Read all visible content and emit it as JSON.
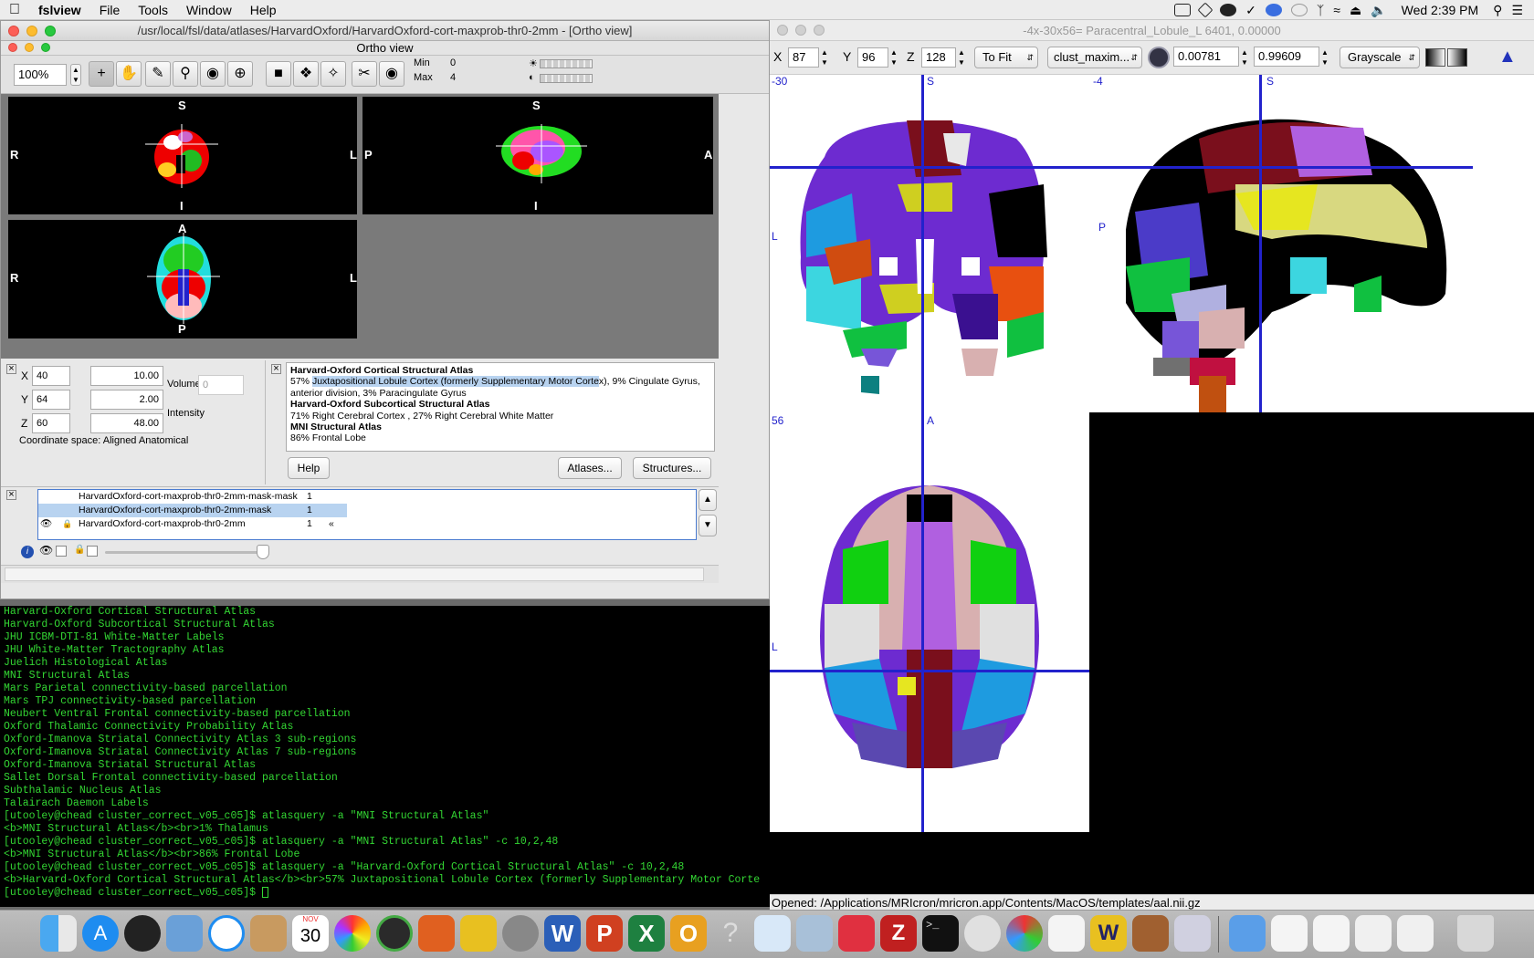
{
  "menubar": {
    "app_name": "fslview",
    "items": [
      "File",
      "Tools",
      "Window",
      "Help"
    ],
    "clock": "Wed 2:39 PM"
  },
  "fsl_window": {
    "title": "/usr/local/fsl/data/atlases/HarvardOxford/HarvardOxford-cort-maxprob-thr0-2mm - [Ortho view]",
    "subtitle": "Ortho view",
    "zoom": "100%",
    "min_label": "Min",
    "min_value": "0",
    "max_label": "Max",
    "max_value": "4",
    "views": {
      "coronal": {
        "top": "S",
        "bottom": "I",
        "left": "R",
        "right": "L"
      },
      "sagittal": {
        "top": "S",
        "bottom": "I",
        "left": "P",
        "right": "A"
      },
      "axial": {
        "top": "A",
        "bottom": "P",
        "left": "R",
        "right": "L"
      }
    },
    "coords": {
      "x_label": "X",
      "x_voxel": "40",
      "x_mm": "10.00",
      "y_label": "Y",
      "y_voxel": "64",
      "y_mm": "2.00",
      "z_label": "Z",
      "z_voxel": "60",
      "z_mm": "48.00",
      "volume_label": "Volume",
      "volume_value": "0",
      "intensity_label": "Intensity",
      "space": "Coordinate space: Aligned Anatomical"
    },
    "atlas_info": {
      "h1": "Harvard-Oxford Cortical Structural Atlas",
      "l1_pre": "57% ",
      "l1_hl": "Juxtapositional Lobule Cortex (formerly Supplementary Motor Corte",
      "l1_post": "x), 9% Cingulate Gyrus,",
      "l2": "anterior division, 3% Paracingulate Gyrus",
      "h2": "Harvard-Oxford Subcortical Structural Atlas",
      "l3": "71% Right Cerebral Cortex , 27% Right Cerebral White Matter",
      "h3": "MNI Structural Atlas",
      "l4": "86% Frontal Lobe",
      "help": "Help",
      "atlases": "Atlases...",
      "structures": "Structures..."
    },
    "layers": [
      {
        "name": "HarvardOxford-cort-maxprob-thr0-2mm-mask-mask",
        "value": "1"
      },
      {
        "name": "HarvardOxford-cort-maxprob-thr0-2mm-mask",
        "value": "1"
      },
      {
        "name": "HarvardOxford-cort-maxprob-thr0-2mm",
        "value": "1"
      }
    ]
  },
  "terminal": {
    "lines": [
      "Harvard-Oxford Cortical Structural Atlas",
      "Harvard-Oxford Subcortical Structural Atlas",
      "JHU ICBM-DTI-81 White-Matter Labels",
      "JHU White-Matter Tractography Atlas",
      "Juelich Histological Atlas",
      "MNI Structural Atlas",
      "Mars Parietal connectivity-based parcellation",
      "Mars TPJ connectivity-based parcellation",
      "Neubert Ventral Frontal connectivity-based parcellation",
      "Oxford Thalamic Connectivity Probability Atlas",
      "Oxford-Imanova Striatal Connectivity Atlas 3 sub-regions",
      "Oxford-Imanova Striatal Connectivity Atlas 7 sub-regions",
      "Oxford-Imanova Striatal Structural Atlas",
      "Sallet Dorsal Frontal connectivity-based parcellation",
      "Subthalamic Nucleus Atlas",
      "Talairach Daemon Labels",
      "[utooley@chead cluster_correct_v05_c05]$ atlasquery -a \"MNI Structural Atlas\"",
      "<b>MNI Structural Atlas</b><br>1% Thalamus",
      "[utooley@chead cluster_correct_v05_c05]$ atlasquery -a \"MNI Structural Atlas\" -c 10,2,48",
      "<b>MNI Structural Atlas</b><br>86% Frontal Lobe",
      "[utooley@chead cluster_correct_v05_c05]$ atlasquery -a \"Harvard-Oxford Cortical Structural Atlas\" -c 10,2,48",
      "<b>Harvard-Oxford Cortical Structural Atlas</b><br>57% Juxtapositional Lobule Cortex (formerly Supplementary Motor Corte",
      "[utooley@chead cluster_correct_v05_c05]$ "
    ]
  },
  "mricron": {
    "title": "-4x-30x56= Paracentral_Lobule_L 6401, 0.00000",
    "x_label": "X",
    "x_value": "87",
    "y_label": "Y",
    "y_value": "96",
    "z_label": "Z",
    "z_value": "128",
    "zoom": "To Fit",
    "overlay": "clust_maxim...",
    "min": "0.00781",
    "max": "0.99609",
    "colormap": "Grayscale",
    "coronal_tag": "-30",
    "coronal_top": "S",
    "coronal_left": "L",
    "sagittal_tag": "-4",
    "sagittal_top": "S",
    "sagittal_left": "P",
    "axial_tag": "56",
    "axial_top": "A",
    "axial_left": "L",
    "status": "Opened: /Applications/MRIcron/mricron.app/Contents/MacOS/templates/aal.nii.gz"
  },
  "dock": {
    "calendar_month": "NOV",
    "calendar_day": "30"
  }
}
